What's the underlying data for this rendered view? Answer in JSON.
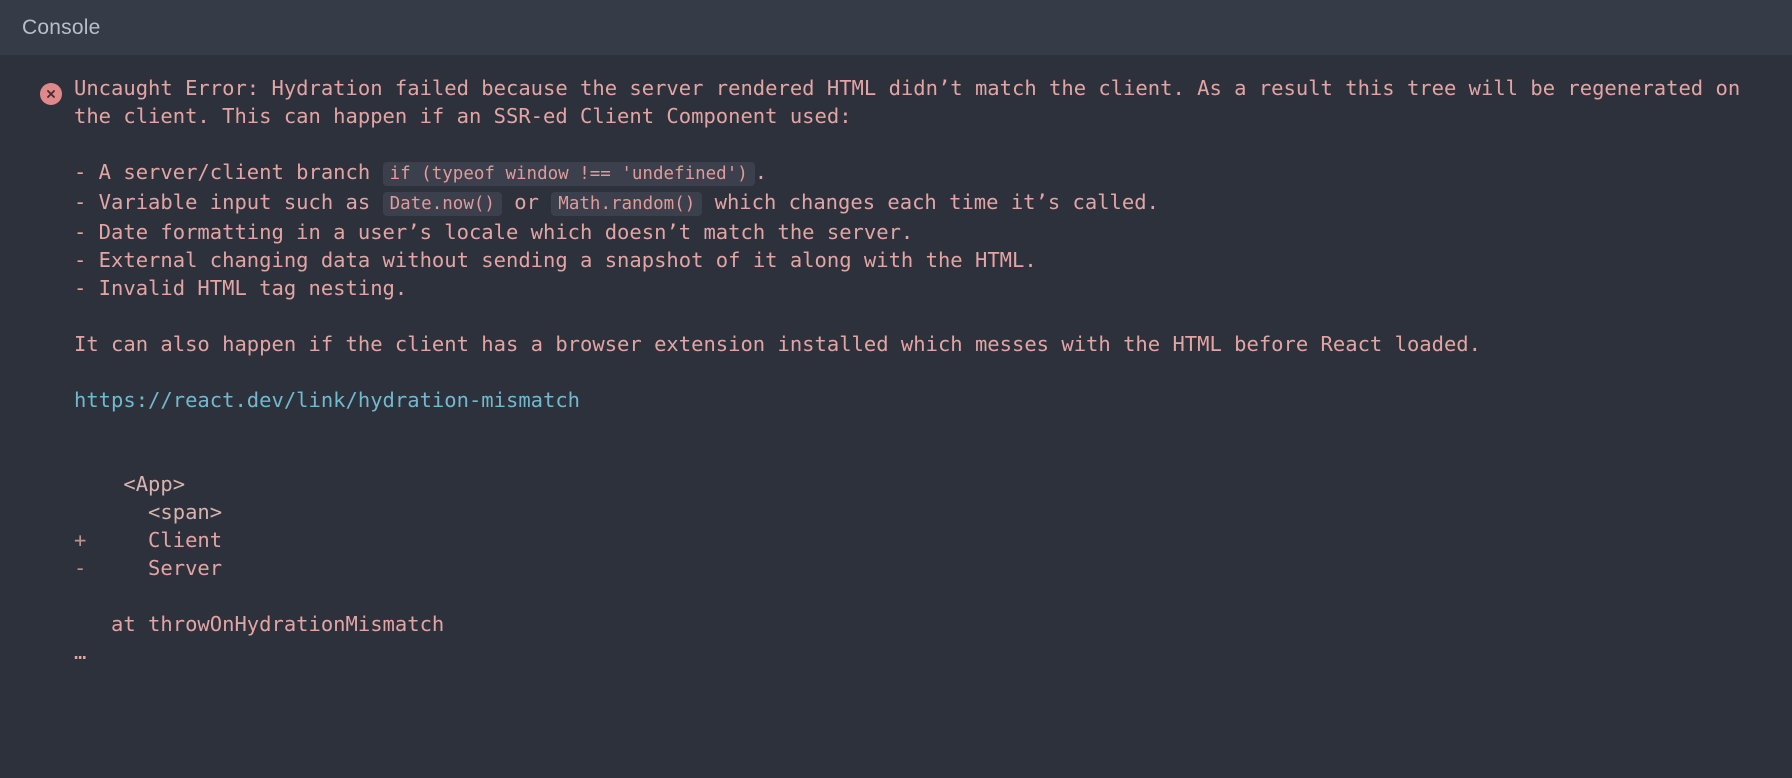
{
  "colors": {
    "header_bg": "#353c48",
    "body_bg": "#2d313c",
    "error_text": "#e3a4a4",
    "error_icon_bg": "#e0898a",
    "code_bg": "#3b404c",
    "link": "#71b9cd",
    "title": "#b9bfc9"
  },
  "header": {
    "title": "Console"
  },
  "error": {
    "icon": "error-circle-x-icon",
    "paragraph_1": "Uncaught Error: Hydration failed because the server rendered HTML didn’t match the client. As a result this tree will be regenerated on the client. This can happen if an SSR-ed Client Component used:",
    "causes": [
      {
        "bullet": "-",
        "parts": [
          {
            "type": "text",
            "value": " A server/client branch "
          },
          {
            "type": "code",
            "value": "if (typeof window !== 'undefined')"
          },
          {
            "type": "text",
            "value": "."
          }
        ]
      },
      {
        "bullet": "-",
        "parts": [
          {
            "type": "text",
            "value": " Variable input such as "
          },
          {
            "type": "code",
            "value": "Date.now()"
          },
          {
            "type": "text",
            "value": " or "
          },
          {
            "type": "code",
            "value": "Math.random()"
          },
          {
            "type": "text",
            "value": " which changes each time it’s called."
          }
        ]
      },
      {
        "bullet": "-",
        "parts": [
          {
            "type": "text",
            "value": " Date formatting in a user’s locale which doesn’t match the server."
          }
        ]
      },
      {
        "bullet": "-",
        "parts": [
          {
            "type": "text",
            "value": " External changing data without sending a snapshot of it along with the HTML."
          }
        ]
      },
      {
        "bullet": "-",
        "parts": [
          {
            "type": "text",
            "value": " Invalid HTML tag nesting."
          }
        ]
      }
    ],
    "paragraph_2": "It can also happen if the client has a browser extension installed which messes with the HTML before React loaded.",
    "link_text": "https://react.dev/link/hydration-mismatch",
    "diff_lines": [
      {
        "sign": " ",
        "indent": 2,
        "content": "<App>",
        "kind": "tag"
      },
      {
        "sign": " ",
        "indent": 4,
        "content": "<span>",
        "kind": "tag"
      },
      {
        "sign": "+",
        "indent": 4,
        "content": "Client",
        "kind": "added"
      },
      {
        "sign": "-",
        "indent": 4,
        "content": "Server",
        "kind": "removed"
      }
    ],
    "stack_frames": [
      "at throwOnHydrationMismatch"
    ],
    "stack_ellipsis": "…"
  }
}
